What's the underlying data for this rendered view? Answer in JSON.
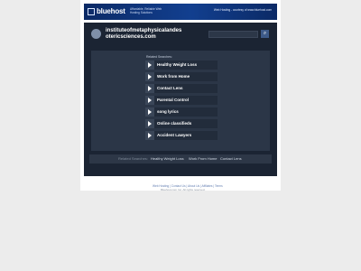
{
  "banner": {
    "logo_text": "bluehost",
    "tagline": "Affordable, Reliable Web Hosting Solutions",
    "sponsor_text": "Web Hosting - courtesy of www.bluehost.com"
  },
  "header": {
    "domain_title": "instituteofmetaphysicalandes otericsciences.com",
    "search_placeholder": "",
    "search_button_icon": "search-icon"
  },
  "panel": {
    "related_label": "Related Searches:",
    "links": [
      {
        "label": "Healthy Weight Loss"
      },
      {
        "label": "Work from Home"
      },
      {
        "label": "Contact Lens"
      },
      {
        "label": "Parental Control"
      },
      {
        "label": "song lyrics"
      },
      {
        "label": "Online classifieds"
      },
      {
        "label": "Accident Lawyers"
      }
    ]
  },
  "footer": {
    "items": [
      {
        "label": "Related Searches:"
      },
      {
        "label": "Healthy Weight Loss"
      },
      {
        "label": "Work From Home"
      },
      {
        "label": "Contact Lens"
      }
    ]
  },
  "bottom_links": "Web Hosting | Contact Us | About Us | Affiliates | Terms",
  "copyright": "Bluehost.com Inc. All rights reserved."
}
